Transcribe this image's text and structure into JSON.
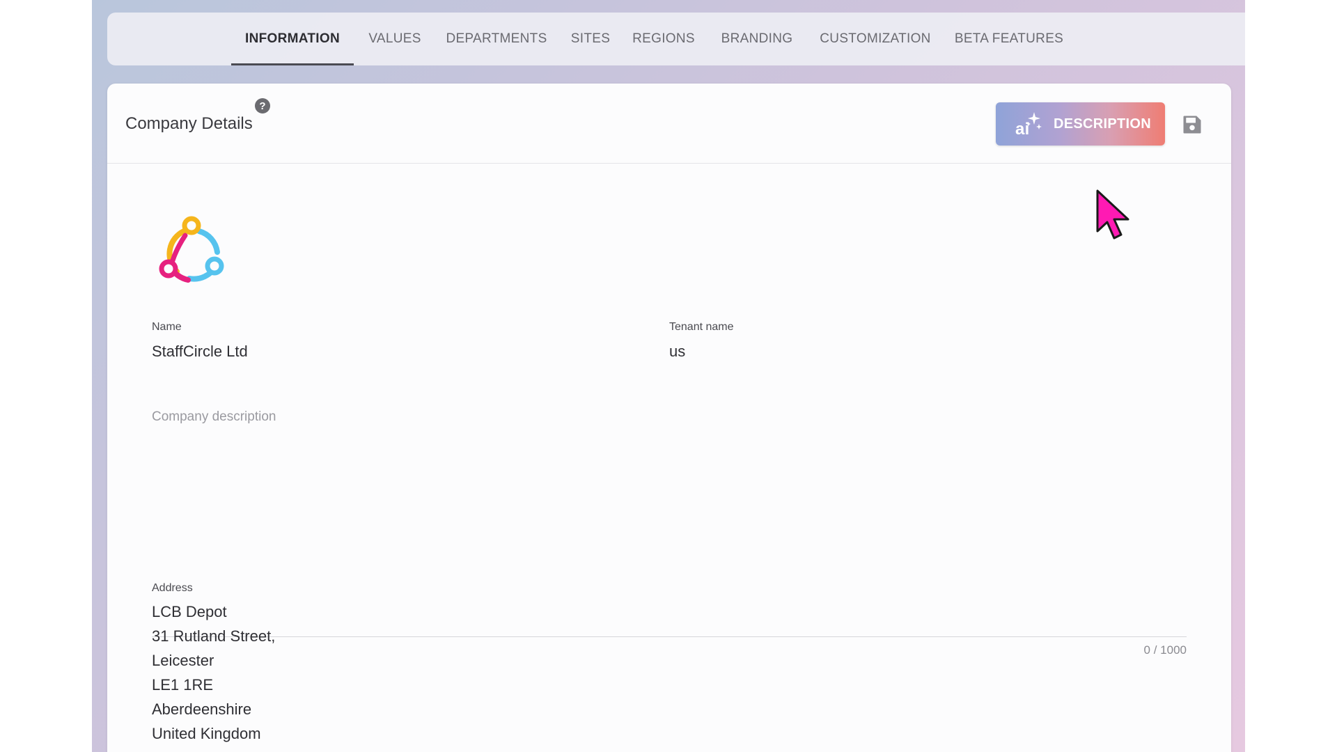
{
  "tabs": [
    {
      "label": "INFORMATION",
      "active": true
    },
    {
      "label": "VALUES",
      "active": false
    },
    {
      "label": "DEPARTMENTS",
      "active": false
    },
    {
      "label": "SITES",
      "active": false
    },
    {
      "label": "REGIONS",
      "active": false
    },
    {
      "label": "BRANDING",
      "active": false
    },
    {
      "label": "CUSTOMIZATION",
      "active": false
    },
    {
      "label": "BETA FEATURES",
      "active": false
    }
  ],
  "card": {
    "title": "Company Details",
    "help_icon": "?",
    "ai_button": {
      "icon_text": "ai",
      "label": "DESCRIPTION",
      "icon": "ai-sparkle-icon"
    },
    "save_icon": "floppy-disk-icon"
  },
  "company": {
    "logo": "staffcircle-logo",
    "name_label": "Name",
    "name_value": "StaffCircle Ltd",
    "tenant_label": "Tenant name",
    "tenant_value": "us",
    "description_placeholder": "Company description",
    "description_value": "",
    "description_counter": "0 / 1000",
    "address_label": "Address",
    "address_lines": [
      "LCB Depot",
      "31 Rutland Street,",
      "Leicester",
      "LE1 1RE",
      "Aberdeenshire",
      "United Kingdom"
    ]
  },
  "colors": {
    "logo_yellow": "#f5b51c",
    "logo_blue": "#56c3ee",
    "logo_pink": "#e6217f",
    "cursor_magenta": "#ff1ab3"
  }
}
